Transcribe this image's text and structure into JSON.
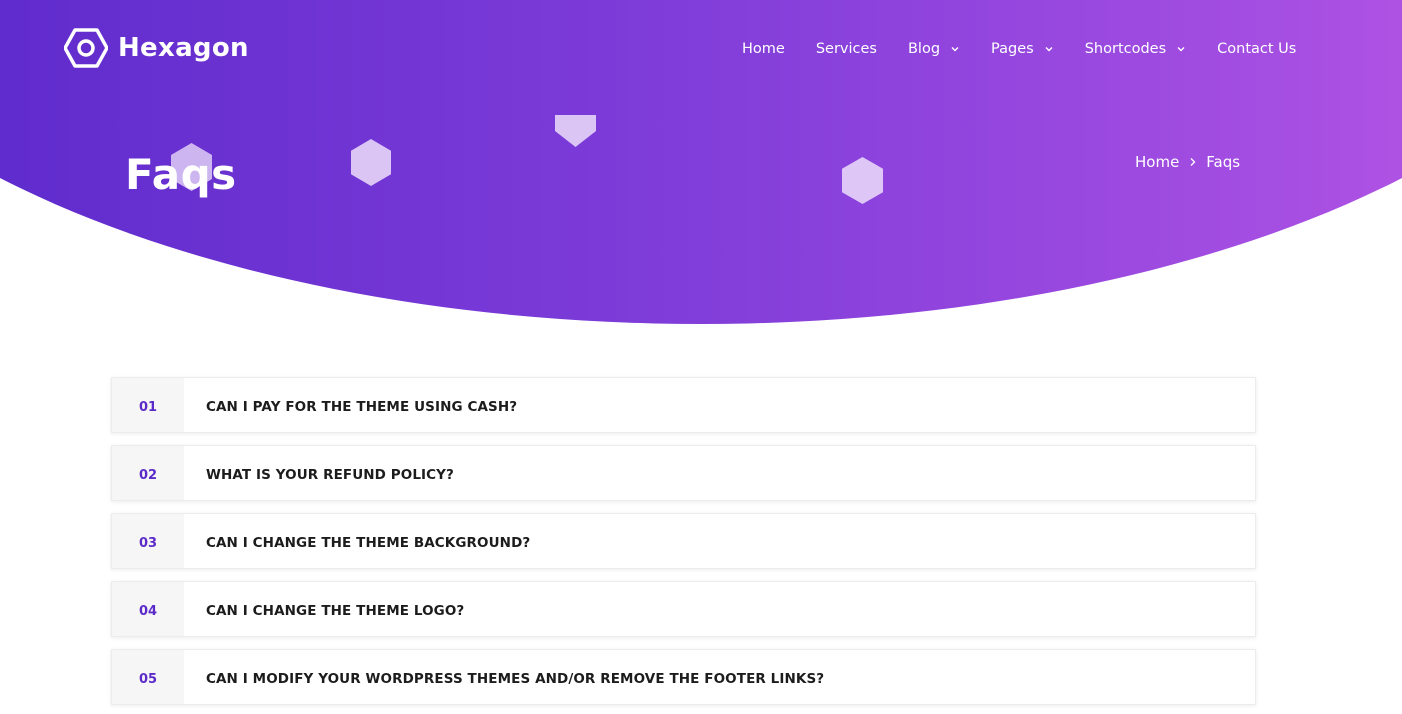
{
  "brand": {
    "name": "Hexagon",
    "logo_icon": "hexagon-logo-icon"
  },
  "nav": {
    "items": [
      {
        "label": "Home",
        "dropdown": false
      },
      {
        "label": "Services",
        "dropdown": false
      },
      {
        "label": "Blog",
        "dropdown": true
      },
      {
        "label": "Pages",
        "dropdown": true
      },
      {
        "label": "Shortcodes",
        "dropdown": true
      },
      {
        "label": "Contact Us",
        "dropdown": false
      }
    ]
  },
  "hero": {
    "title": "Faqs",
    "breadcrumb": {
      "home": "Home",
      "current": "Faqs",
      "separator_icon": "chevron-right-icon"
    }
  },
  "faqs": [
    {
      "number": "01",
      "question": "CAN I PAY FOR THE THEME USING CASH?"
    },
    {
      "number": "02",
      "question": "WHAT IS YOUR REFUND POLICY?"
    },
    {
      "number": "03",
      "question": "CAN I CHANGE THE THEME BACKGROUND?"
    },
    {
      "number": "04",
      "question": "CAN I CHANGE THE THEME LOGO?"
    },
    {
      "number": "05",
      "question": "CAN I MODIFY YOUR WORDPRESS THEMES AND/OR REMOVE THE FOOTER LINKS?"
    }
  ],
  "colors": {
    "hero_start": "#5425c8",
    "hero_end": "#c05ae6",
    "accent": "#5b2ac9",
    "question_text": "#1c1c1c"
  }
}
